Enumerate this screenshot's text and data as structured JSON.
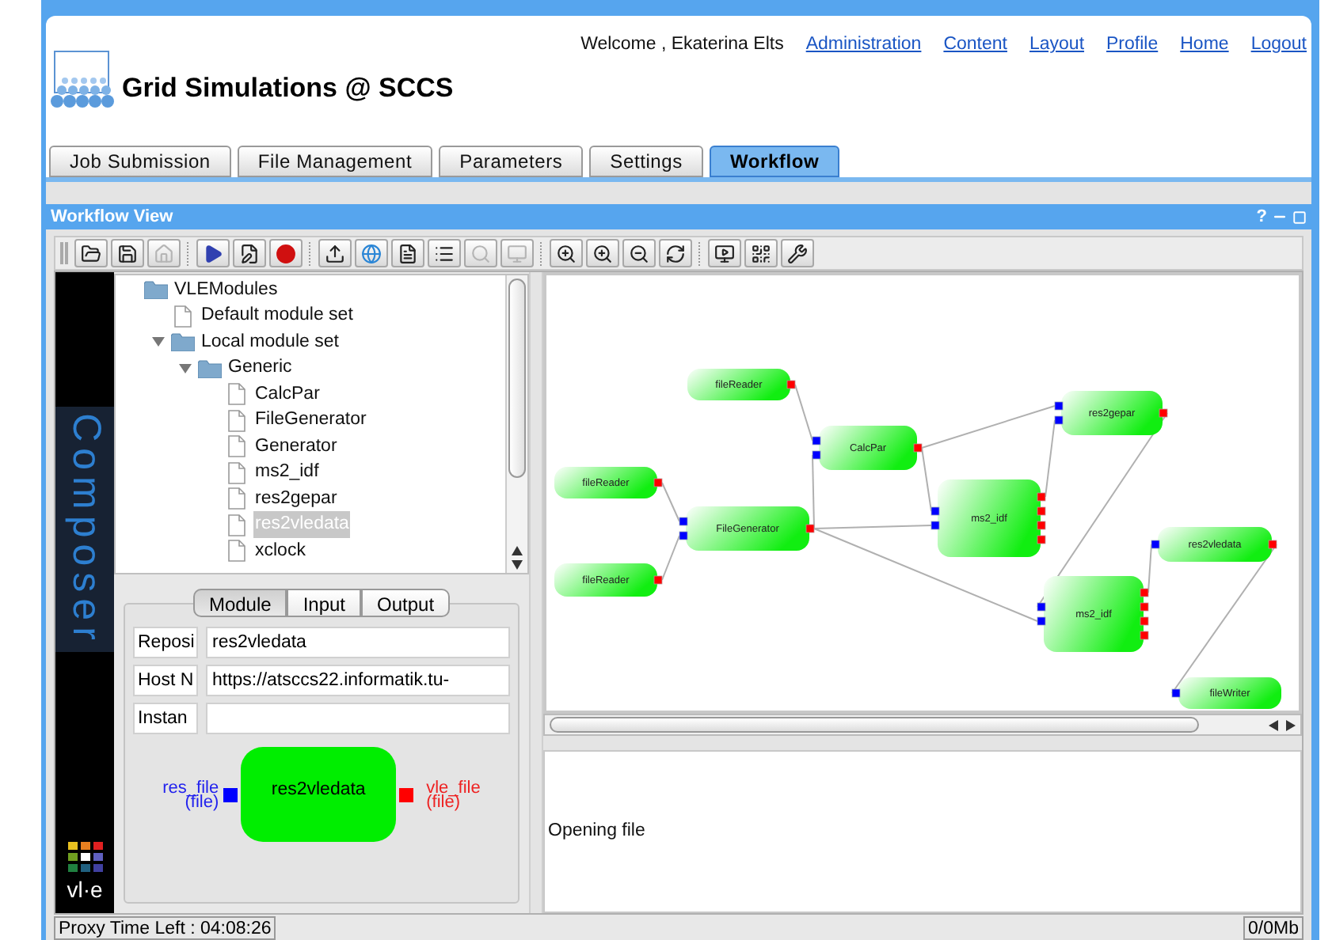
{
  "header": {
    "welcome": "Welcome , Ekaterina Elts",
    "links": [
      "Administration",
      "Content",
      "Layout",
      "Profile",
      "Home",
      "Logout"
    ],
    "title": "Grid Simulations @ SCCS"
  },
  "tabs": [
    {
      "label": "Job Submission",
      "selected": false
    },
    {
      "label": "File Management",
      "selected": false
    },
    {
      "label": "Parameters",
      "selected": false
    },
    {
      "label": "Settings",
      "selected": false
    },
    {
      "label": "Workflow",
      "selected": true
    }
  ],
  "portlet": {
    "title": "Workflow View",
    "help": "?"
  },
  "toolbar": [
    {
      "disabled": false
    },
    {
      "disabled": false
    },
    {
      "disabled": true
    },
    {
      "disabled": false
    },
    {
      "disabled": false
    },
    {
      "disabled": false
    },
    {
      "disabled": false
    },
    {
      "disabled": false
    },
    {
      "disabled": false
    },
    {
      "disabled": false
    },
    {
      "disabled": true
    },
    {
      "disabled": true
    },
    {
      "disabled": false
    },
    {
      "disabled": false
    },
    {
      "disabled": false
    },
    {
      "disabled": false
    },
    {
      "disabled": false
    },
    {
      "disabled": false
    },
    {
      "disabled": false
    }
  ],
  "sidebar": {
    "label": "Composer",
    "logo": "vl·e"
  },
  "tree": [
    {
      "label": "VLEModules",
      "kind": "folder",
      "selected": false,
      "children": [
        {
          "label": "Default module set",
          "kind": "file",
          "selected": false
        },
        {
          "label": "Local module set",
          "kind": "folder",
          "selected": false,
          "expanded": true,
          "children": [
            {
              "label": "Generic",
              "kind": "folder",
              "selected": false,
              "expanded": true,
              "children": [
                {
                  "label": "CalcPar",
                  "kind": "file",
                  "selected": false
                },
                {
                  "label": "FileGenerator",
                  "kind": "file",
                  "selected": false
                },
                {
                  "label": "Generator",
                  "kind": "file",
                  "selected": false
                },
                {
                  "label": "ms2_idf",
                  "kind": "file",
                  "selected": false
                },
                {
                  "label": "res2gepar",
                  "kind": "file",
                  "selected": false
                },
                {
                  "label": "res2vledata",
                  "kind": "file",
                  "selected": true
                },
                {
                  "label": "xclock",
                  "kind": "file",
                  "selected": false
                }
              ]
            }
          ]
        }
      ]
    }
  ],
  "module_panel": {
    "tabs": [
      {
        "label": "Module",
        "selected": true
      },
      {
        "label": "Input",
        "selected": false
      },
      {
        "label": "Output",
        "selected": false
      }
    ],
    "fields": [
      {
        "label": "Reposi",
        "value": "res2vledata"
      },
      {
        "label": "Host N",
        "value": "https://atsccs22.informatik.tu-"
      },
      {
        "label": "Instan"
      }
    ],
    "diagram": {
      "node": "res2vledata",
      "input": {
        "name": "res_file",
        "type": "(file)"
      },
      "output": {
        "name": "vle_file",
        "type": "(file)"
      }
    }
  },
  "graph": {
    "nodes": [
      {
        "label": "fileReader"
      },
      {
        "label": "CalcPar"
      },
      {
        "label": "res2gepar"
      },
      {
        "label": "fileReader"
      },
      {
        "label": "FileGenerator"
      },
      {
        "label": "ms2_idf"
      },
      {
        "label": "res2vledata"
      },
      {
        "label": "fileReader"
      },
      {
        "label": "ms2_idf"
      },
      {
        "label": "fileWriter"
      }
    ]
  },
  "log": {
    "text": "Opening file"
  },
  "status_bar": {
    "proxy": "Proxy Time Left : 04:08:26",
    "memory": "0/0Mb"
  }
}
